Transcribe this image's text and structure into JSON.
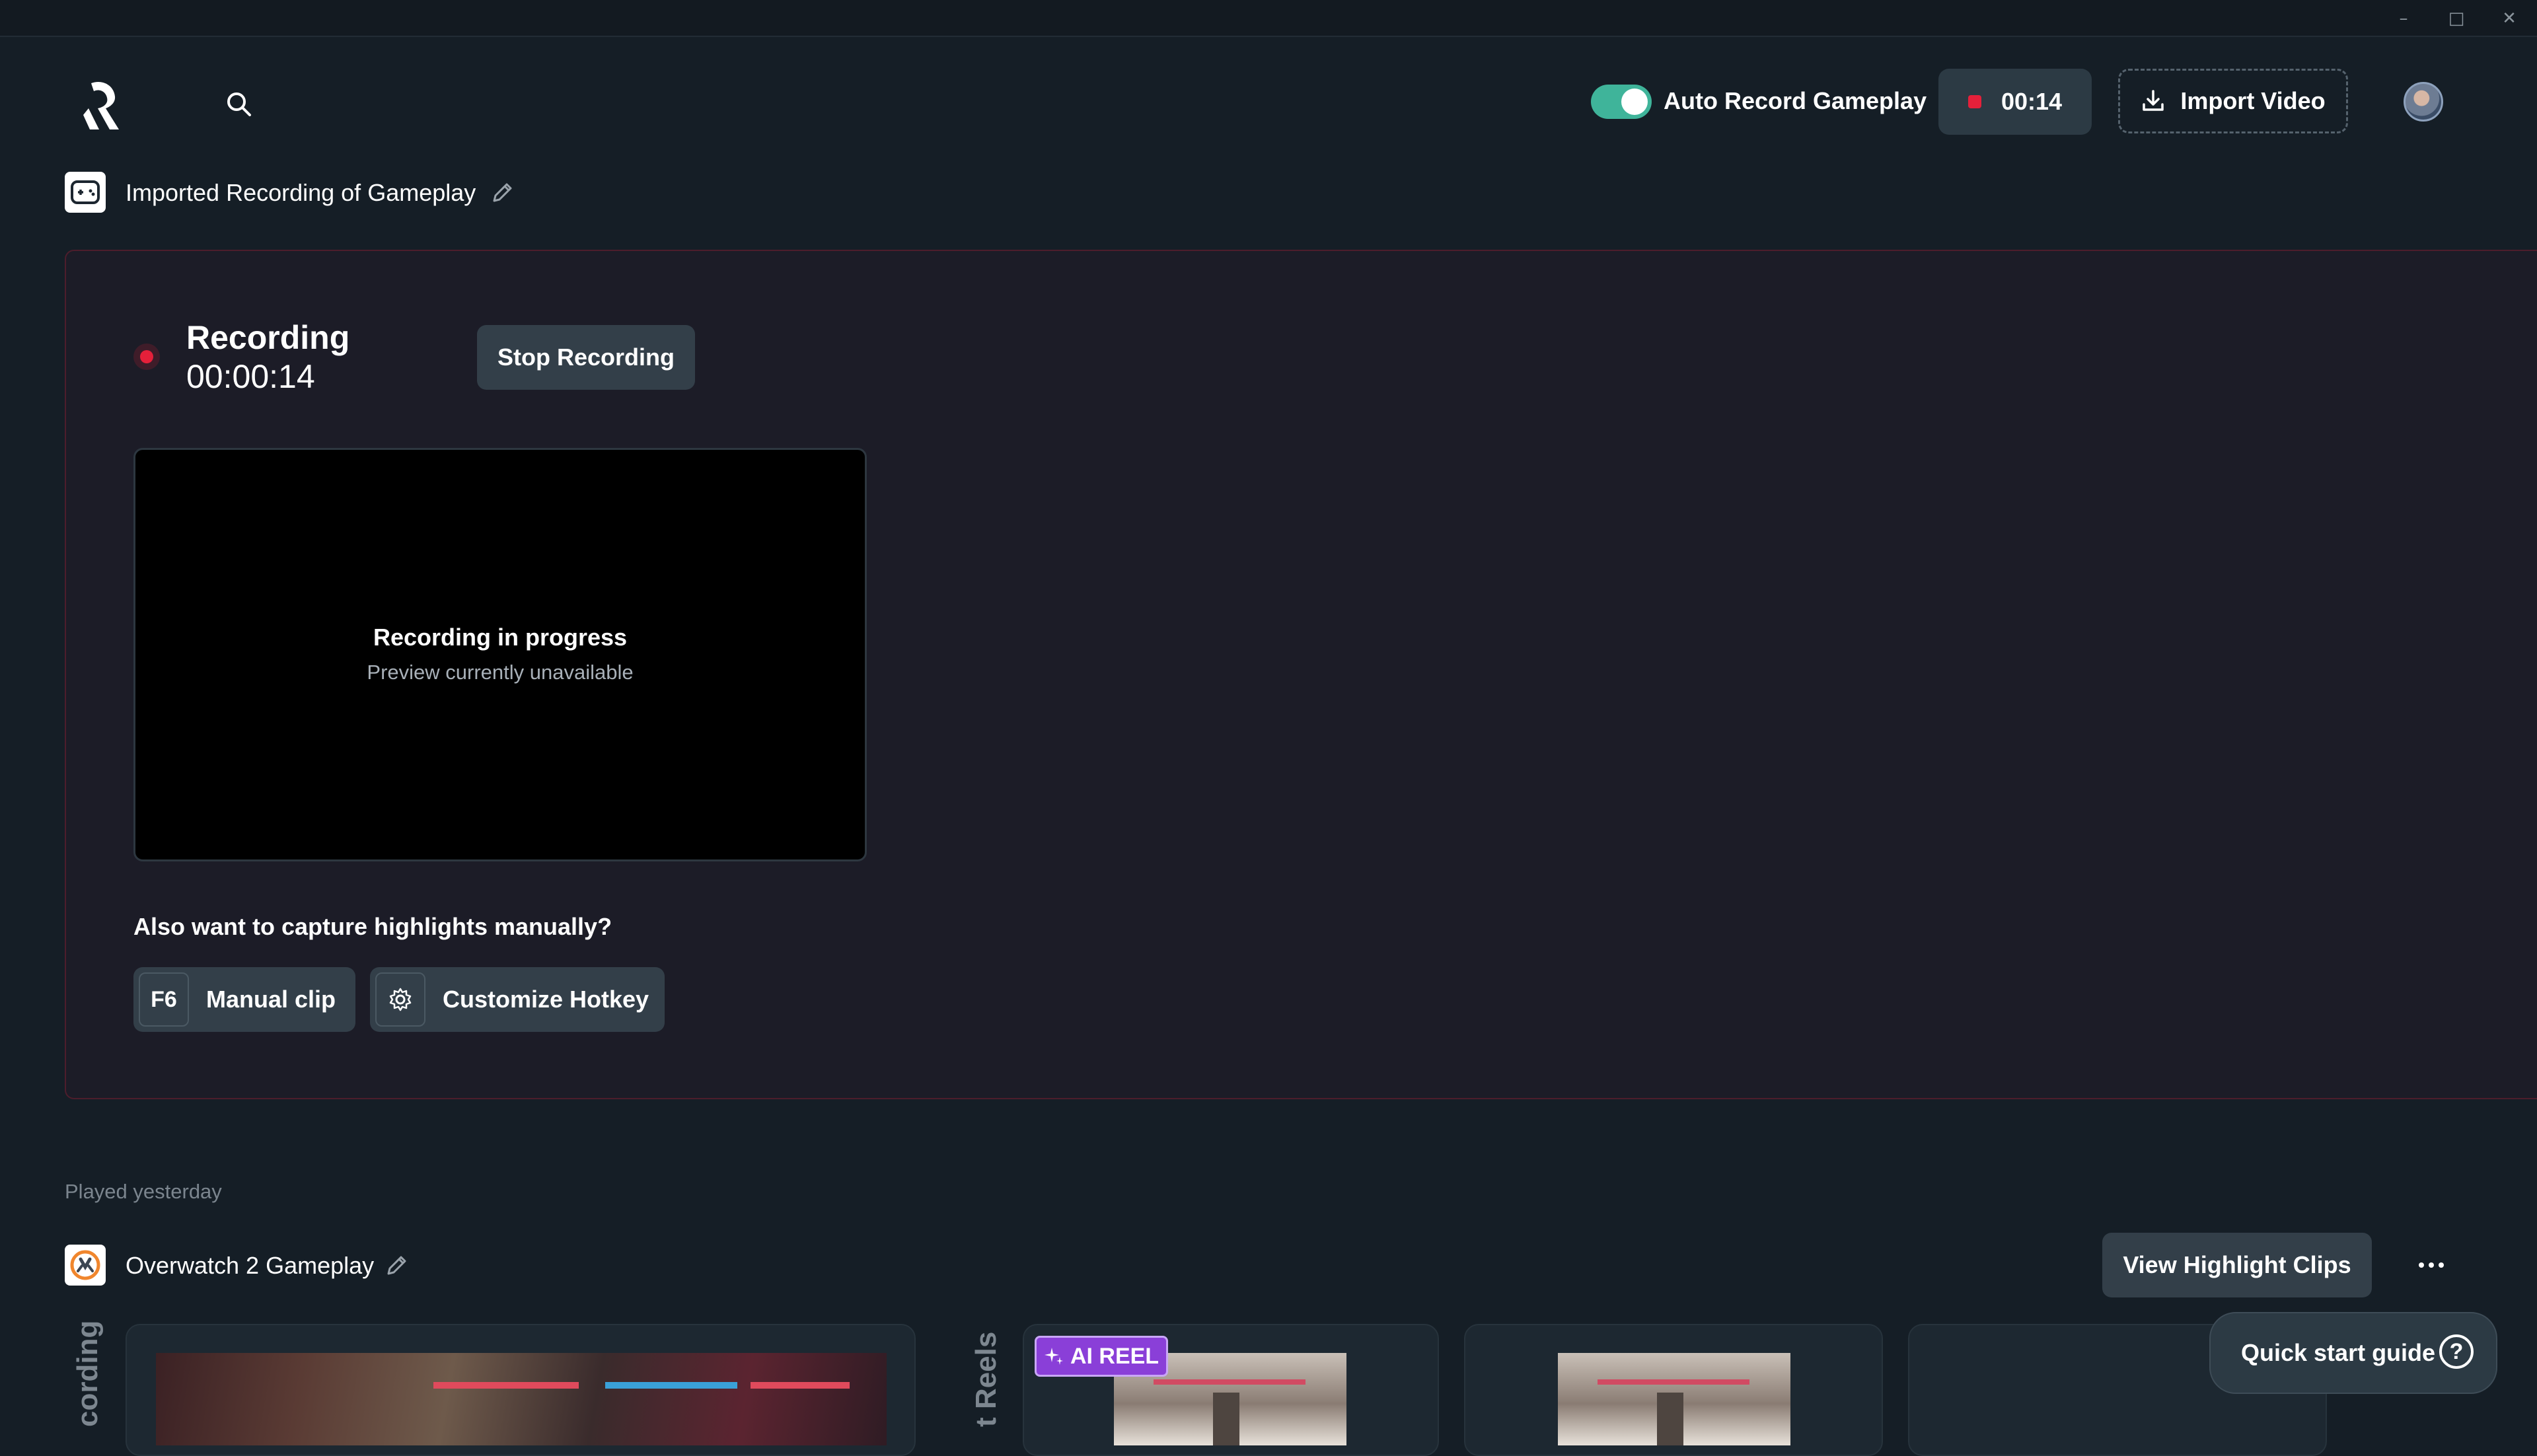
{
  "window": {
    "minimize": "–",
    "maximize": "□",
    "close": "✕"
  },
  "header": {
    "auto_record_label": "Auto Record Gameplay",
    "auto_record_on": true,
    "timer": "00:14",
    "import_label": "Import Video"
  },
  "current_recording": {
    "title": "Imported Recording of Gameplay",
    "status": "Recording",
    "elapsed": "00:00:14",
    "stop_label": "Stop Recording",
    "preview_title": "Recording in progress",
    "preview_subtitle": "Preview currently unavailable",
    "highlight_question": "Also want to capture highlights manually?",
    "manual_key": "F6",
    "manual_label": "Manual clip",
    "hotkey_label": "Customize Hotkey"
  },
  "history": {
    "section_label": "Played yesterday",
    "game_title": "Overwatch 2 Gameplay",
    "view_clips_label": "View Highlight Clips",
    "recording_column_label": "cording",
    "reels_column_label": "t Reels",
    "ai_reel_badge": "AI REEL"
  },
  "quick_start": {
    "label": "Quick start guide",
    "help_glyph": "?"
  },
  "colors": {
    "accent_toggle": "#3fb49a",
    "record_red": "#e5203a",
    "ai_purple": "#8a3fd8"
  }
}
